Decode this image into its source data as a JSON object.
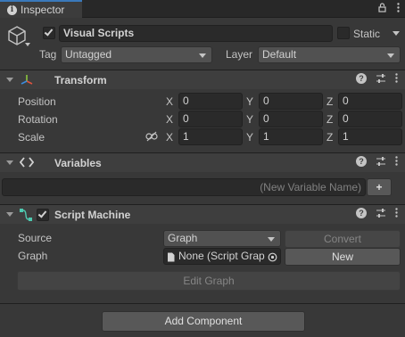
{
  "tab": {
    "title": "Inspector",
    "icon": "info-icon"
  },
  "header": {
    "object_name": "Visual Scripts",
    "static_label": "Static",
    "tag_label": "Tag",
    "tag_value": "Untagged",
    "layer_label": "Layer",
    "layer_value": "Default"
  },
  "transform": {
    "title": "Transform",
    "rows": [
      {
        "label": "Position",
        "x": "0",
        "y": "0",
        "z": "0"
      },
      {
        "label": "Rotation",
        "x": "0",
        "y": "0",
        "z": "0"
      },
      {
        "label": "Scale",
        "x": "1",
        "y": "1",
        "z": "1"
      }
    ],
    "axes": {
      "x": "X",
      "y": "Y",
      "z": "Z"
    }
  },
  "variables": {
    "title": "Variables",
    "placeholder": "(New Variable Name)",
    "add_label": "+"
  },
  "script_machine": {
    "title": "Script Machine",
    "source_label": "Source",
    "source_value": "Graph",
    "convert_label": "Convert",
    "graph_label": "Graph",
    "graph_value": "None (Script Grap",
    "new_label": "New",
    "edit_graph_label": "Edit Graph"
  },
  "footer": {
    "add_component_label": "Add Component"
  },
  "colors": {
    "accent": "#3a79bb",
    "transform_x": "#e0533f",
    "transform_y": "#8cc63f",
    "transform_z": "#3a8de0",
    "script_machine": "#4ec9b0"
  }
}
